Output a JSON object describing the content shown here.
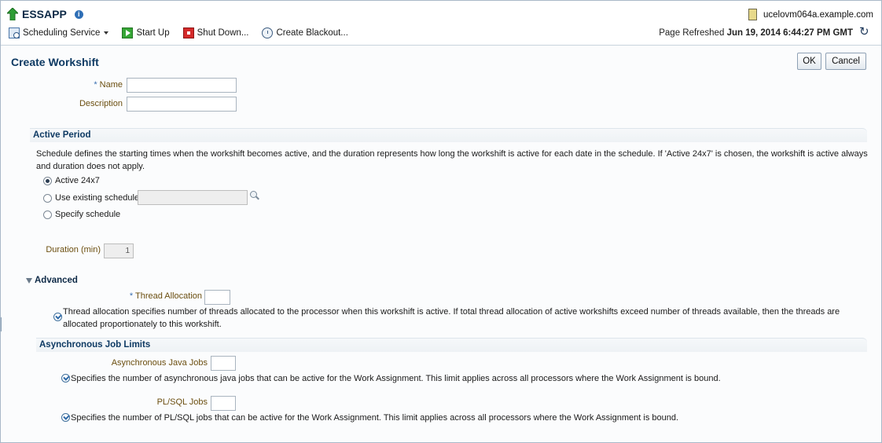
{
  "app": {
    "title": "ESSAPP",
    "host": "ucelovm064a.example.com"
  },
  "toolbar": {
    "scheduling_service": "Scheduling Service",
    "start_up": "Start Up",
    "shut_down": "Shut Down...",
    "create_blackout": "Create Blackout...",
    "refreshed_label": "Page Refreshed",
    "refreshed_value": "Jun 19, 2014 6:44:27 PM GMT"
  },
  "page": {
    "title": "Create Workshift",
    "ok": "OK",
    "cancel": "Cancel"
  },
  "form": {
    "name_label": "Name",
    "name_value": "",
    "description_label": "Description",
    "description_value": ""
  },
  "active_period": {
    "header": "Active Period",
    "help": "Schedule defines the starting times when the workshift becomes active, and the duration represents how long the workshift is active for each date in the schedule. If 'Active 24x7' is chosen, the workshift is active always and duration does not apply.",
    "options": [
      "Active 24x7",
      "Use existing schedule",
      "Specify schedule"
    ],
    "selected": "Active 24x7",
    "schedule_value": "",
    "duration_label": "Duration (min)",
    "duration_value": "1"
  },
  "advanced": {
    "header": "Advanced",
    "thread_label": "Thread Allocation",
    "thread_value": "",
    "thread_help": "Thread allocation specifies number of threads allocated to the processor when this workshift is active. If total thread allocation of active workshifts exceed number of threads available, then the threads are allocated proportionately to this workshift."
  },
  "async": {
    "header": "Asynchronous Job Limits",
    "java_label": "Asynchronous Java Jobs",
    "java_value": "",
    "java_help": "Specifies the number of asynchronous java jobs that can be active for the Work Assignment. This limit applies across all processors where the Work Assignment is bound.",
    "plsql_label": "PL/SQL Jobs",
    "plsql_value": "",
    "plsql_help": "Specifies the number of PL/SQL jobs that can be active for the Work Assignment. This limit applies across all processors where the Work Assignment is bound."
  },
  "colors": {
    "accent": "#0e3a63",
    "label": "#6b4e0f"
  }
}
